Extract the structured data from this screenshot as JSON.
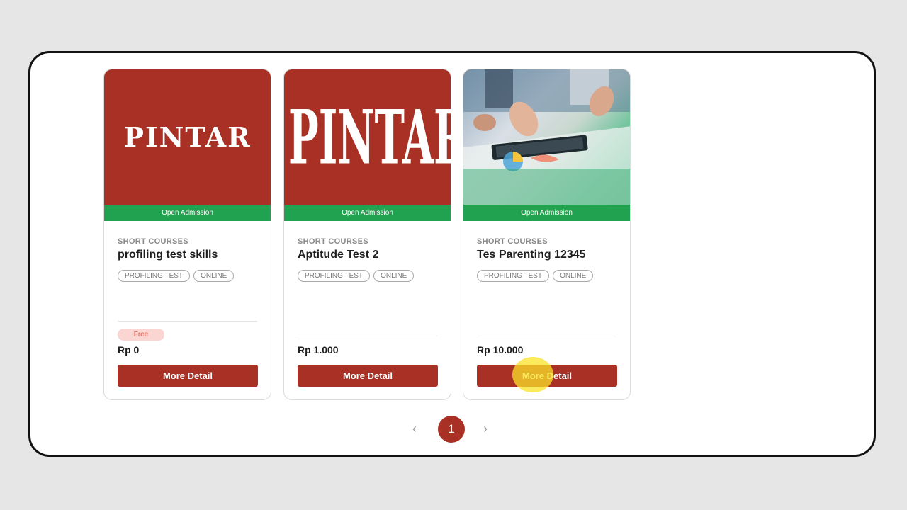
{
  "cards": [
    {
      "logo_text": "PINTAR",
      "admission": "Open Admission",
      "category": "SHORT COURSES",
      "title": "profiling test skills",
      "tags": [
        "PROFILING TEST",
        "ONLINE"
      ],
      "badge": "Free",
      "price": "Rp 0",
      "button": "More Detail"
    },
    {
      "logo_text": "PINTAR",
      "admission": "Open Admission",
      "category": "SHORT COURSES",
      "title": "Aptitude Test 2",
      "tags": [
        "PROFILING TEST",
        "ONLINE"
      ],
      "price": "Rp 1.000",
      "button": "More Detail"
    },
    {
      "admission": "Open Admission",
      "category": "SHORT COURSES",
      "title": "Tes Parenting 12345",
      "tags": [
        "PROFILING TEST",
        "ONLINE"
      ],
      "price": "Rp 10.000",
      "button": "More Detail"
    }
  ],
  "pagination": {
    "prev_icon": "‹",
    "current_page": "1",
    "next_icon": "›"
  },
  "colors": {
    "brand": "#a83024",
    "admission_green": "#21a251",
    "free_badge_bg": "#fbd5d1"
  }
}
